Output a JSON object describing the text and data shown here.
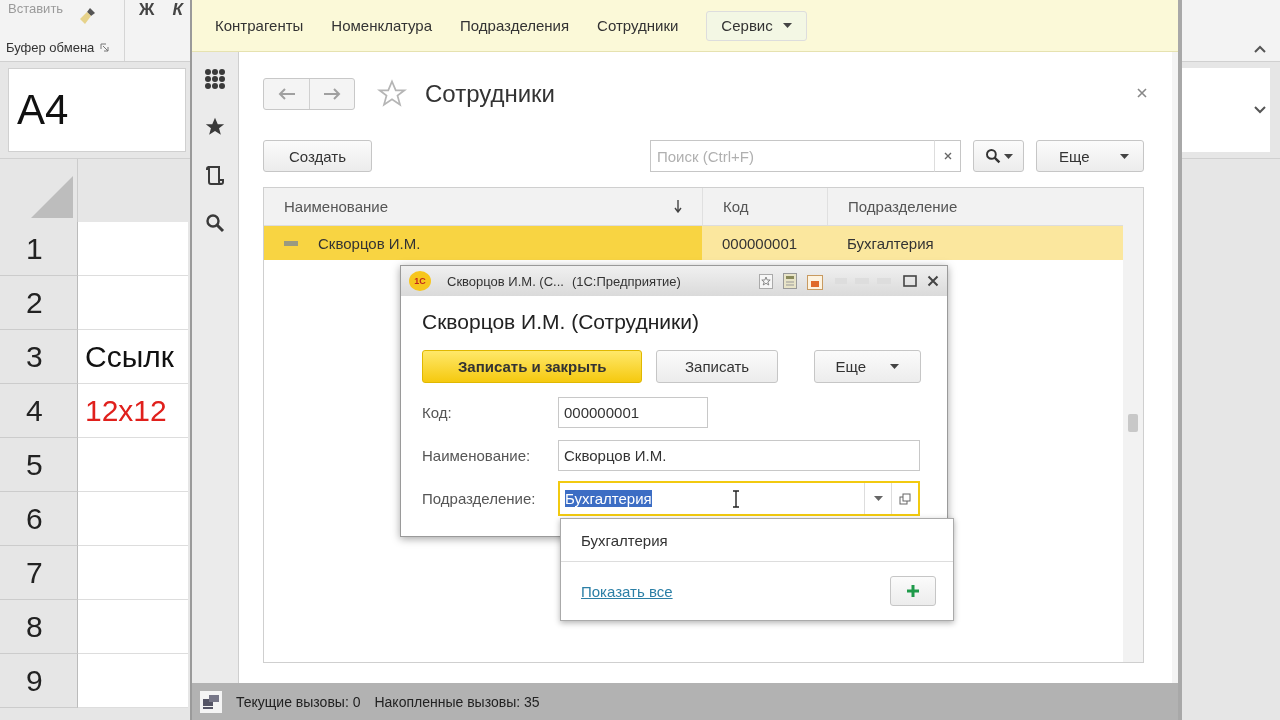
{
  "excel": {
    "ribbon": {
      "paste_label": "Вставить",
      "bold_key": "Ж",
      "italic_key": "К",
      "group_label": "Буфер обмена"
    },
    "name_box": "A4",
    "rows": [
      {
        "number": "1"
      },
      {
        "number": "2"
      },
      {
        "number": "3",
        "text": "Ссылк",
        "color": "#111111"
      },
      {
        "number": "4",
        "text": "12x12",
        "color": "#e0201c"
      },
      {
        "number": "5"
      },
      {
        "number": "6"
      },
      {
        "number": "7"
      },
      {
        "number": "8"
      },
      {
        "number": "9"
      }
    ]
  },
  "app": {
    "nav": [
      {
        "label": "Контрагенты",
        "kind": "link"
      },
      {
        "label": "Номенклатура",
        "kind": "link"
      },
      {
        "label": "Подразделения",
        "kind": "link"
      },
      {
        "label": "Сотрудники",
        "kind": "link"
      },
      {
        "label": "Сервис",
        "kind": "dropdown"
      }
    ],
    "form": {
      "title": "Сотрудники",
      "create_button": "Создать",
      "search": {
        "placeholder": "Поиск (Ctrl+F)"
      },
      "more_button": "Еще",
      "table": {
        "columns": [
          {
            "label": "Наименование",
            "sorted": true
          },
          {
            "label": "Код",
            "sorted": false
          },
          {
            "label": "Подразделение",
            "sorted": false
          }
        ],
        "rows": [
          {
            "cells": [
              "Скворцов И.М.",
              "000000001",
              "Бухгалтерия"
            ],
            "selected": true
          }
        ]
      }
    },
    "status_bar": {
      "current_calls": "Текущие вызовы: 0",
      "accumulated_calls": "Накопленные вызовы: 35"
    }
  },
  "dialog": {
    "logo": "1С",
    "window_title": "Скворцов И.М. (С...",
    "app_name": "(1С:Предприятие)",
    "title": "Скворцов И.М. (Сотрудники)",
    "buttons": [
      {
        "label": "Записать и закрыть",
        "kind": "primary"
      },
      {
        "label": "Записать",
        "kind": "default"
      },
      {
        "label": "Еще",
        "kind": "menu"
      }
    ],
    "fields": [
      {
        "label": "Код:",
        "value": "000000001",
        "kind": "short",
        "focused": false
      },
      {
        "label": "Наименование:",
        "value": "Скворцов И.М.",
        "kind": "text",
        "focused": false
      },
      {
        "label": "Подразделение:",
        "value": "Бухгалтерия",
        "kind": "choice",
        "focused": true
      }
    ]
  },
  "dropdown": {
    "items": [
      "Бухгалтерия"
    ],
    "show_all_link": "Показать все"
  }
}
